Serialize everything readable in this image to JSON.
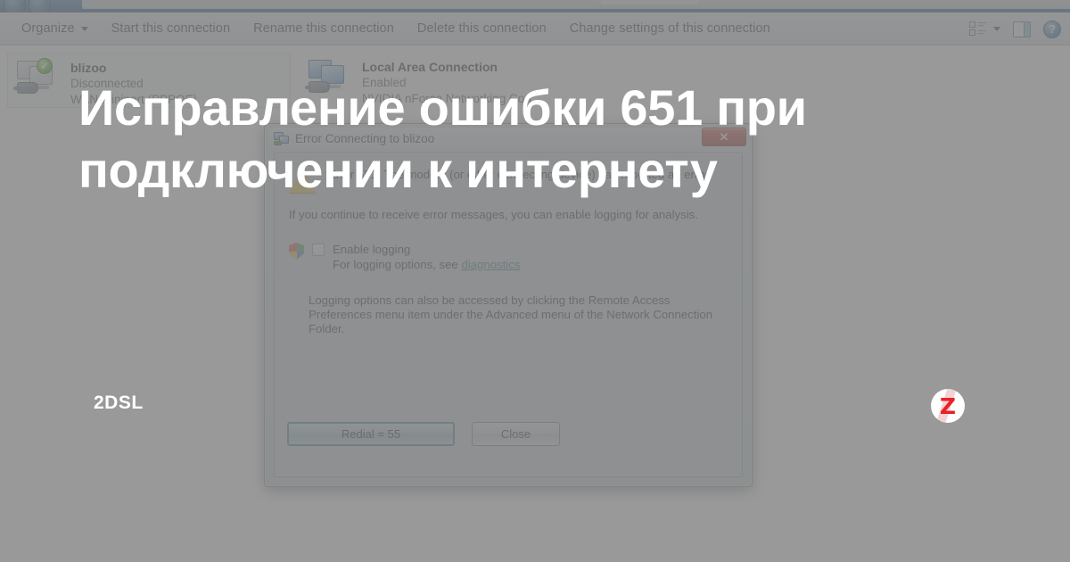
{
  "headline": {
    "line1": "Исправление ошибки 651 при",
    "line2": "подключении к интернету"
  },
  "brand": {
    "label": "2DSL",
    "zen_logo": "zen-logo-icon",
    "zen_letter": "Z"
  },
  "window": {
    "toolbar": {
      "items": [
        {
          "label": "Organize",
          "has_caret": true
        },
        {
          "label": "Start this connection",
          "has_caret": false
        },
        {
          "label": "Rename this connection",
          "has_caret": false
        },
        {
          "label": "Delete this connection",
          "has_caret": false
        },
        {
          "label": "Change settings of this connection",
          "has_caret": false
        }
      ],
      "right_icons": [
        "views-icon",
        "chevron-down-icon",
        "preview-pane-icon",
        "help-icon"
      ],
      "help_glyph": "?"
    },
    "connections": [
      {
        "name": "blizoo",
        "status": "Disconnected",
        "device": "WAN Miniport (PPPOE)",
        "icon": "dialup-connection-icon",
        "badge": "✓",
        "selected": true
      },
      {
        "name": "Local Area Connection",
        "status": "Enabled",
        "device": "NVIDIA nForce Networking Con...",
        "icon": "lan-connection-icon",
        "badge": "",
        "selected": false
      }
    ]
  },
  "dialog": {
    "title": "Error Connecting to blizoo",
    "title_icon": "connection-icon",
    "close_label": "✕",
    "warning_icon": "warning-triangle-icon",
    "error_text": "Error 651: The modem (or other connecting device) has reported an error.",
    "advice_text": "If you continue to receive error messages, you can enable logging for analysis.",
    "shield_icon": "uac-shield-icon",
    "checkbox_label": "Enable logging",
    "logging_options_prefix": "For logging options, see ",
    "logging_options_link": "diagnostics",
    "note_text": "Logging options can also be accessed by clicking the Remote Access Preferences menu item under the Advanced menu of the Network Connection Folder.",
    "buttons": {
      "redial": "Redial = 55",
      "close": "Close"
    }
  },
  "colors": {
    "accent_blue": "#1f5a91",
    "scrim_gray": "#808080",
    "link_teal": "#2d6f7d",
    "close_red": "#b2382d",
    "zen_red": "#ec2027",
    "default_button_border": "#3f7f8e"
  }
}
